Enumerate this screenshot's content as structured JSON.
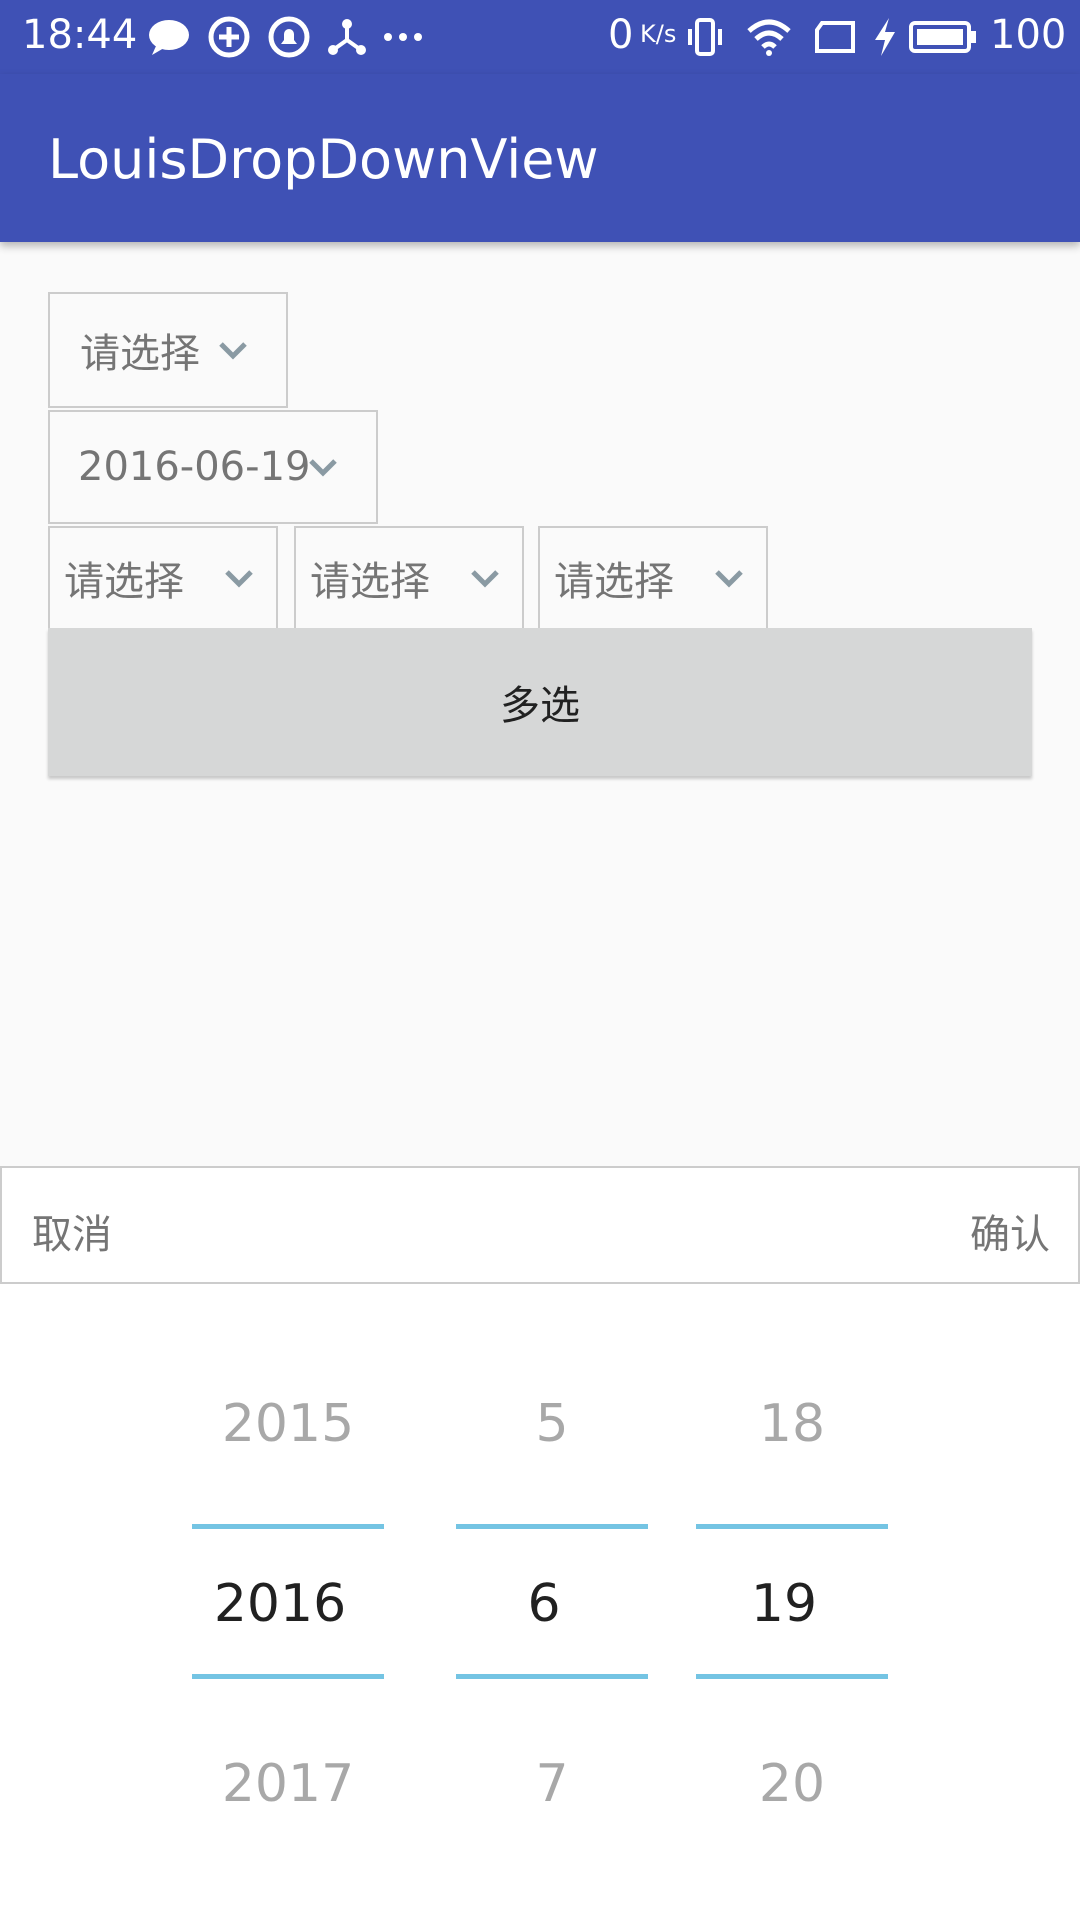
{
  "status_bar": {
    "time": "18:44",
    "network_speed": "0",
    "network_unit": "K/s",
    "battery": "100",
    "icons": [
      "chat-icon",
      "sync-icon",
      "notification-bell-icon",
      "share-node-icon",
      "more-dots-icon",
      "vibrate-icon",
      "wifi-icon",
      "sim-icon",
      "charging-icon",
      "battery-icon"
    ]
  },
  "appbar": {
    "title": "LouisDropDownView"
  },
  "dropdown_1": {
    "label": "请选择"
  },
  "dropdown_date": {
    "label": "2016-06-19"
  },
  "dropdown_row": [
    {
      "label": "请选择"
    },
    {
      "label": "请选择"
    },
    {
      "label": "请选择"
    }
  ],
  "multi_button": {
    "label": "多选"
  },
  "picker_bar": {
    "cancel": "取消",
    "confirm": "确认"
  },
  "picker": {
    "year": {
      "prev": "2015",
      "selected": "2016",
      "next": "2017"
    },
    "month": {
      "prev": "5",
      "selected": "6",
      "next": "7"
    },
    "day": {
      "prev": "18",
      "selected": "19",
      "next": "20"
    }
  },
  "colors": {
    "primary": "#3f51b5",
    "wheel_line": "#74c4e3",
    "button_bg": "#d6d7d7"
  }
}
